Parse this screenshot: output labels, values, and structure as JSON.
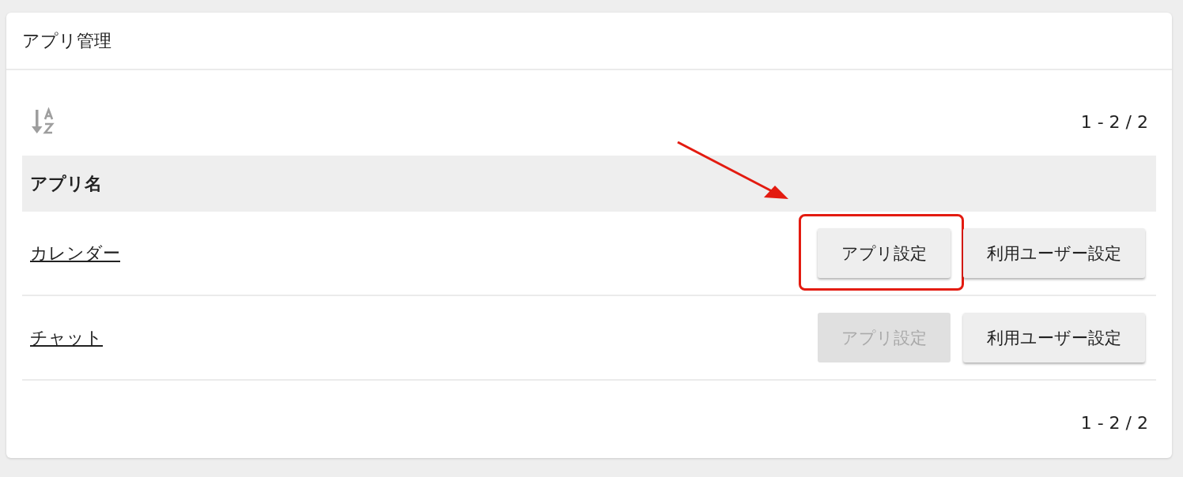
{
  "card": {
    "title": "アプリ管理"
  },
  "pagination_top": "1 - 2 / 2",
  "table": {
    "columns": [
      "アプリ名"
    ],
    "rows": [
      {
        "name": "カレンダー",
        "buttons": [
          {
            "label": "アプリ設定",
            "disabled": false,
            "highlighted": true
          },
          {
            "label": "利用ユーザー設定",
            "disabled": false,
            "highlighted": false
          }
        ]
      },
      {
        "name": "チャット",
        "buttons": [
          {
            "label": "アプリ設定",
            "disabled": true,
            "highlighted": false
          },
          {
            "label": "利用ユーザー設定",
            "disabled": false,
            "highlighted": false
          }
        ]
      }
    ]
  },
  "pagination_bottom": "1 - 2 / 2"
}
